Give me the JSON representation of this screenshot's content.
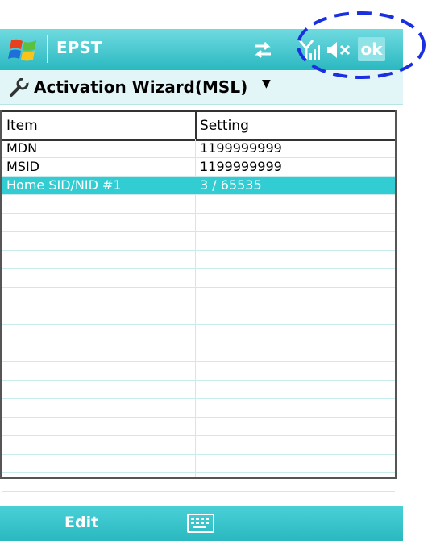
{
  "titlebar": {
    "app_title": "EPST",
    "ok_label": "ok",
    "icons": [
      "windows-start-icon",
      "connectivity-icon",
      "signal-icon",
      "speaker-mute-icon"
    ]
  },
  "header": {
    "title": "Activation Wizard(MSL)",
    "icon": "wrench-icon"
  },
  "table": {
    "columns": [
      "Item",
      "Setting"
    ],
    "rows": [
      {
        "item": "MDN",
        "setting": "1199999999"
      },
      {
        "item": "MSID",
        "setting": "1199999999"
      },
      {
        "item": "Home SID/NID #1",
        "setting": "3 / 65535",
        "selected": true
      }
    ]
  },
  "bottombar": {
    "left_softkey": "Edit",
    "center_icon": "keyboard-icon"
  },
  "colors": {
    "accent": "#31cdd3",
    "titlebar": "#2ab8c0",
    "annotation": "#1a2fe0"
  }
}
